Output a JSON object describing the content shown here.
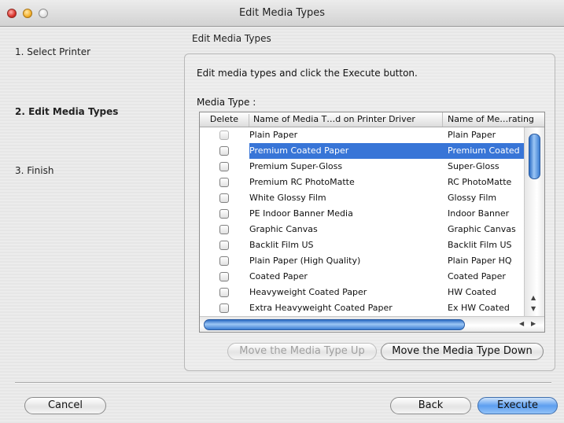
{
  "window": {
    "title": "Edit Media Types"
  },
  "steps": [
    {
      "label": "1. Select Printer",
      "active": false
    },
    {
      "label": "2. Edit Media Types",
      "active": true
    },
    {
      "label": "3. Finish",
      "active": false
    }
  ],
  "section": {
    "title": "Edit Media Types",
    "instruction": "Edit media types and click the Execute button.",
    "media_type_label": "Media Type :"
  },
  "table": {
    "columns": [
      "Delete",
      "Name of Media T…d on Printer Driver",
      "Name of Me…rating"
    ],
    "rows": [
      {
        "delete": false,
        "driver_name": "Plain Paper",
        "short_name": "Plain Paper"
      },
      {
        "delete": false,
        "driver_name": "Premium Coated Paper",
        "short_name": "Premium Coated",
        "selected": true
      },
      {
        "delete": false,
        "driver_name": "Premium Super-Gloss",
        "short_name": "Super-Gloss"
      },
      {
        "delete": false,
        "driver_name": "Premium RC PhotoMatte",
        "short_name": "RC PhotoMatte"
      },
      {
        "delete": false,
        "driver_name": "White Glossy Film",
        "short_name": "Glossy Film"
      },
      {
        "delete": false,
        "driver_name": "PE Indoor Banner Media",
        "short_name": "Indoor Banner"
      },
      {
        "delete": false,
        "driver_name": "Graphic Canvas",
        "short_name": "Graphic Canvas"
      },
      {
        "delete": false,
        "driver_name": "Backlit Film US",
        "short_name": "Backlit Film US"
      },
      {
        "delete": false,
        "driver_name": "Plain Paper (High Quality)",
        "short_name": "Plain Paper HQ"
      },
      {
        "delete": false,
        "driver_name": "Coated Paper",
        "short_name": "Coated Paper"
      },
      {
        "delete": false,
        "driver_name": "Heavyweight Coated Paper",
        "short_name": "HW Coated"
      },
      {
        "delete": false,
        "driver_name": "Extra Heavyweight Coated Paper",
        "short_name": "Ex HW Coated"
      }
    ]
  },
  "buttons": {
    "move_up": "Move the Media Type Up",
    "move_down": "Move the Media Type Down",
    "cancel": "Cancel",
    "back": "Back",
    "execute": "Execute"
  },
  "colors": {
    "selection": "#3875d7",
    "accent": "#5d9ff0"
  },
  "icons": {
    "close": "close-icon",
    "minimize": "minimize-icon",
    "zoom": "zoom-icon",
    "scroll_up": "scroll-up-icon",
    "scroll_down": "scroll-down-icon",
    "scroll_left": "scroll-left-icon",
    "scroll_right": "scroll-right-icon"
  }
}
